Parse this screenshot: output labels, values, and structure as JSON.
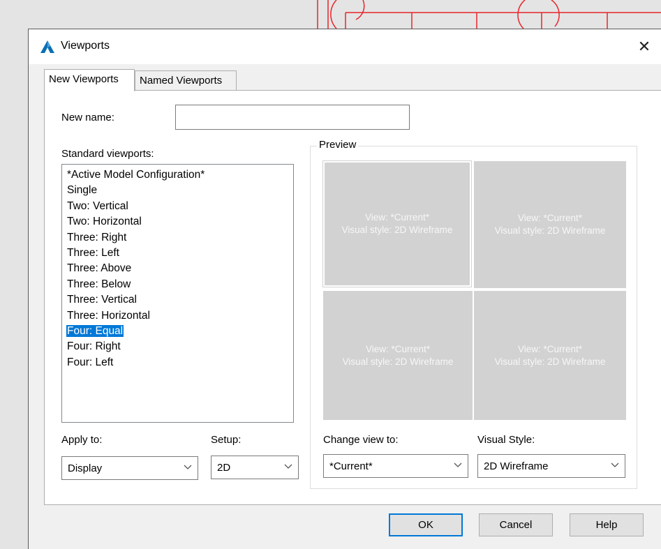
{
  "window": {
    "title": "Viewports"
  },
  "tabs": [
    {
      "label": "New Viewports",
      "active": true
    },
    {
      "label": "Named Viewports",
      "active": false
    }
  ],
  "new_name": {
    "label": "New name:",
    "value": ""
  },
  "standard_viewports": {
    "label": "Standard viewports:",
    "items": [
      "*Active Model Configuration*",
      "Single",
      "Two:  Vertical",
      "Two:  Horizontal",
      "Three: Right",
      "Three: Left",
      "Three: Above",
      "Three: Below",
      "Three: Vertical",
      "Three: Horizontal",
      "Four:  Equal",
      "Four:  Right",
      "Four:  Left"
    ],
    "selected_index": 10
  },
  "preview": {
    "title": "Preview",
    "panes": [
      {
        "view": "View: *Current*",
        "style": "Visual style: 2D Wireframe"
      },
      {
        "view": "View: *Current*",
        "style": "Visual style: 2D Wireframe"
      },
      {
        "view": "View: *Current*",
        "style": "Visual style: 2D Wireframe"
      },
      {
        "view": "View: *Current*",
        "style": "Visual style: 2D Wireframe"
      }
    ]
  },
  "apply_to": {
    "label": "Apply to:",
    "value": "Display"
  },
  "setup": {
    "label": "Setup:",
    "value": "2D"
  },
  "change_view": {
    "label": "Change view to:",
    "value": "*Current*"
  },
  "visual_style": {
    "label": "Visual Style:",
    "value": "2D Wireframe"
  },
  "buttons": {
    "ok": "OK",
    "cancel": "Cancel",
    "help": "Help"
  },
  "colors": {
    "accent": "#0078d7",
    "drawing_lines": "#e8242a",
    "preview_pane": "#d2d2d2"
  }
}
